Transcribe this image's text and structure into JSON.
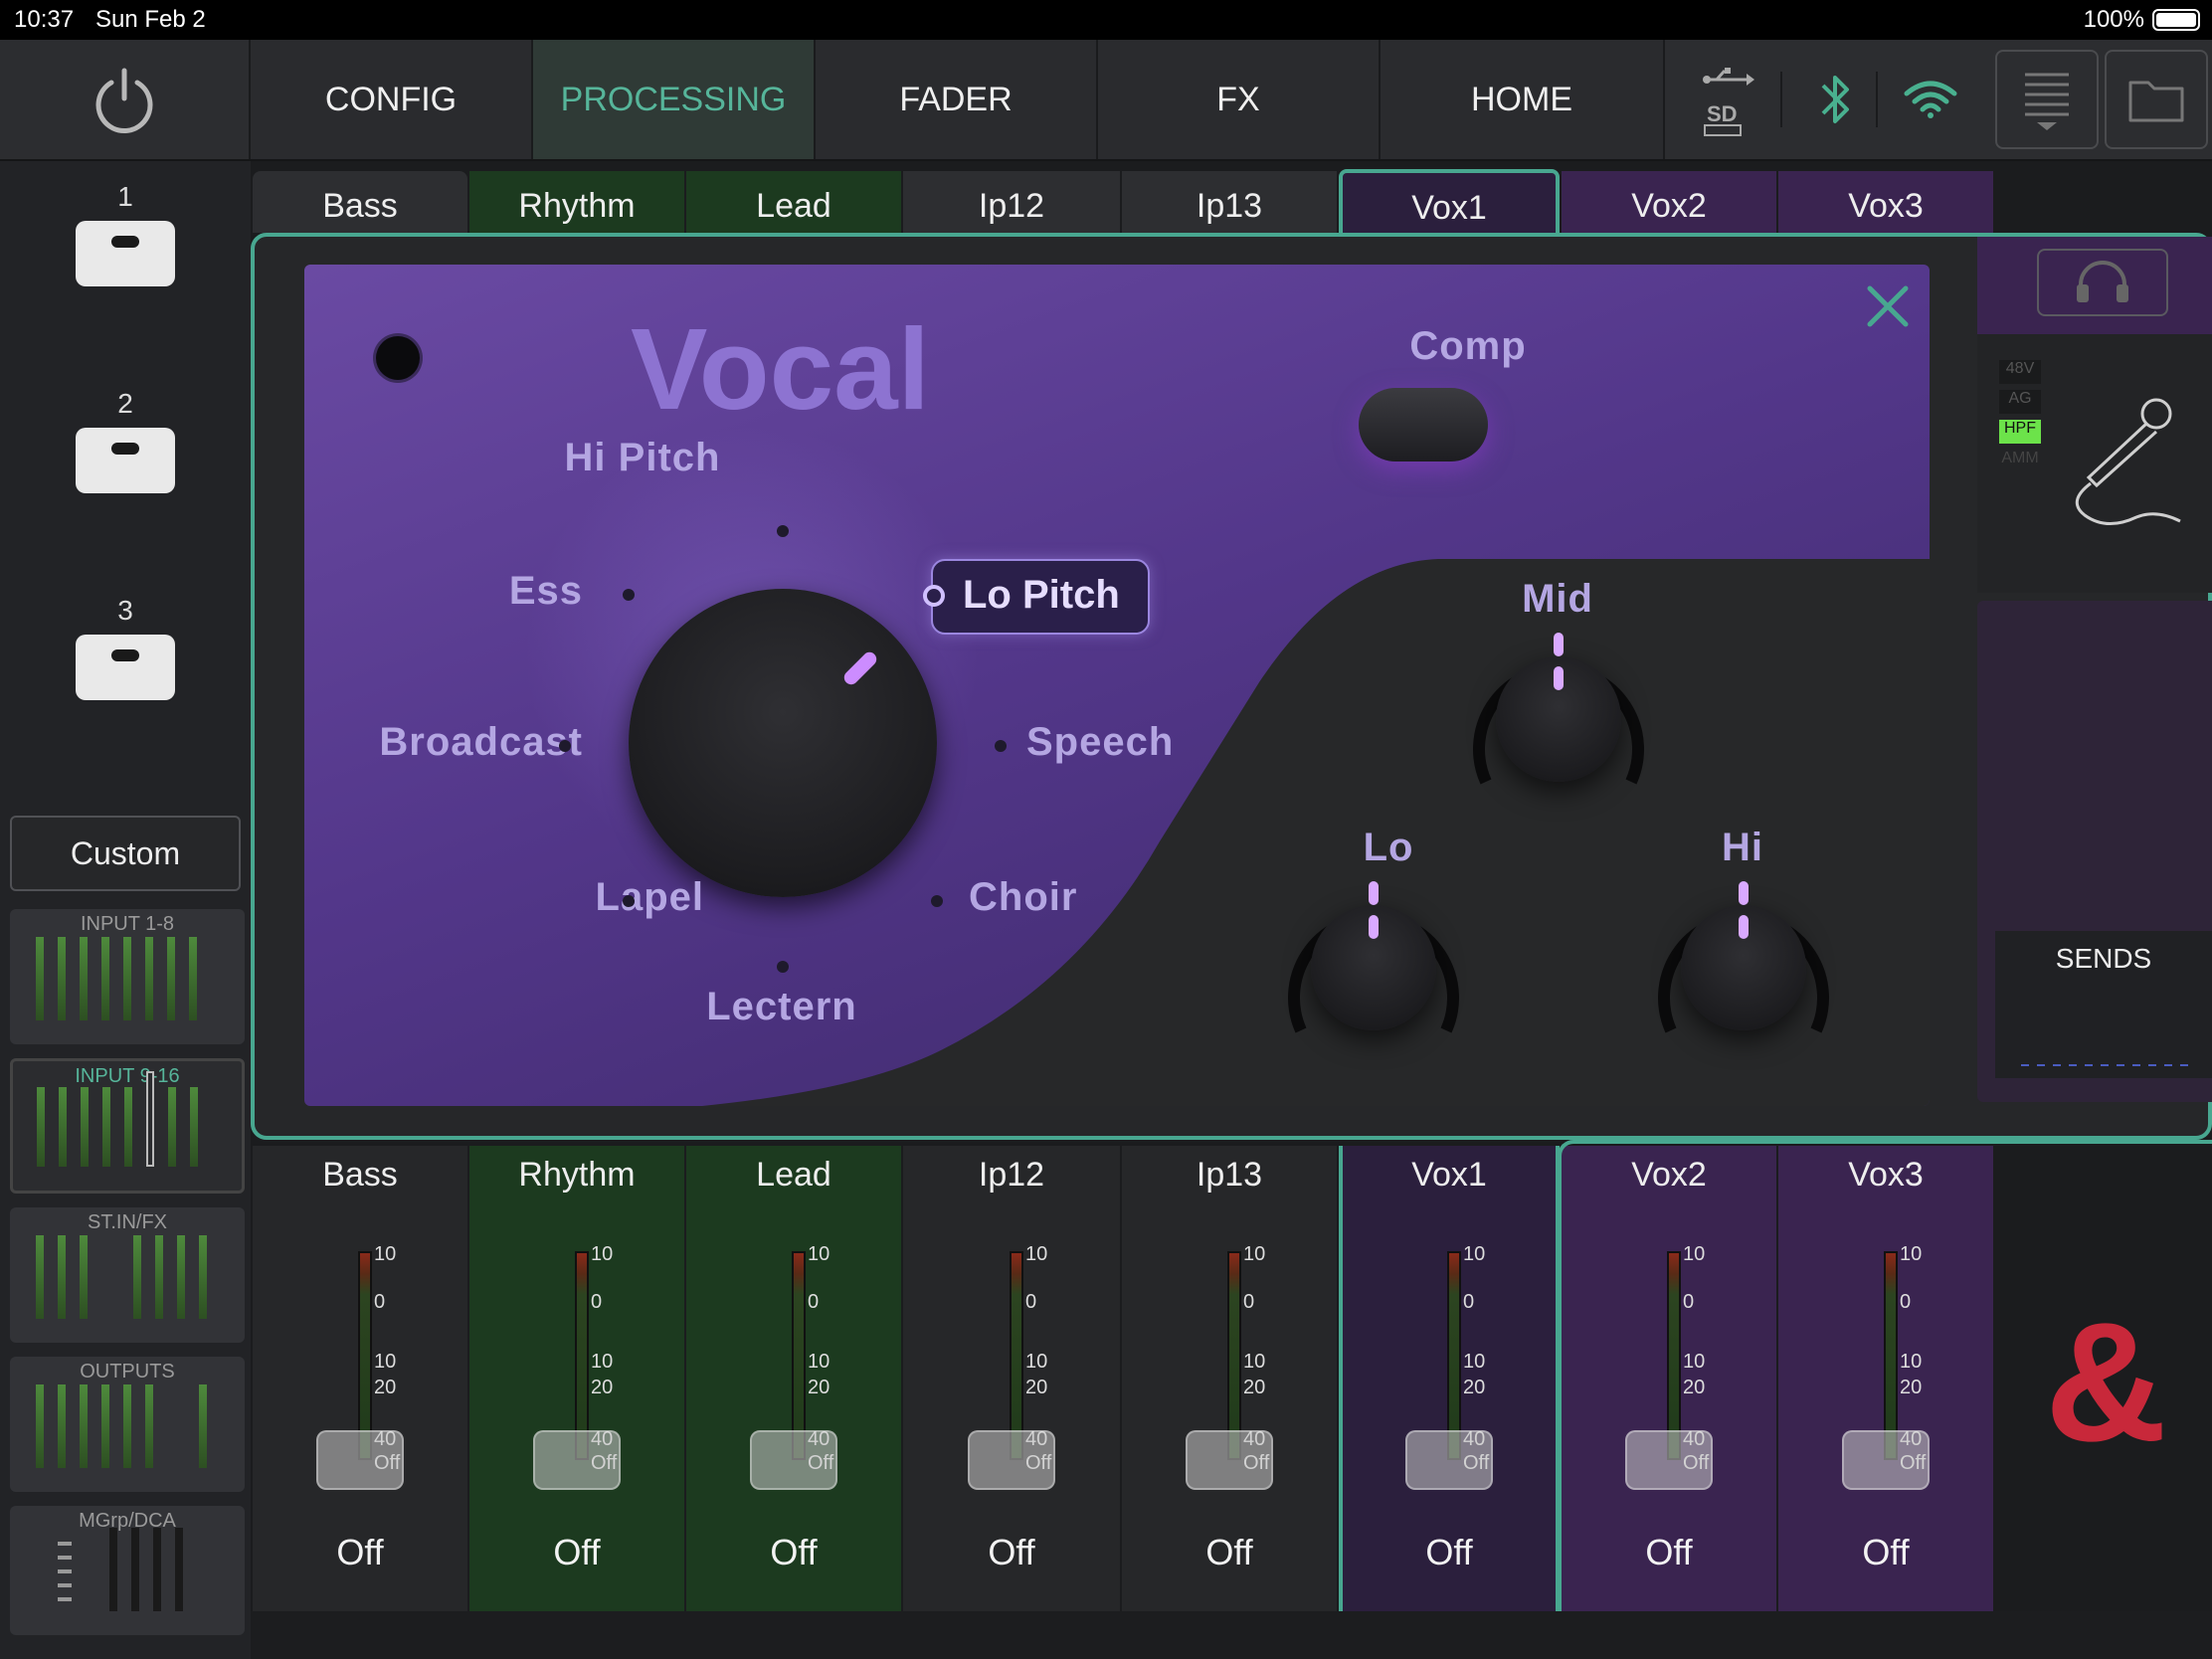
{
  "status_bar": {
    "time": "10:37",
    "date": "Sun Feb 2",
    "battery": "100%"
  },
  "nav": {
    "tabs": [
      "CONFIG",
      "PROCESSING",
      "FADER",
      "FX",
      "HOME"
    ],
    "active": "PROCESSING",
    "icons": [
      "power-icon",
      "usb-icon",
      "sd-card-icon",
      "bluetooth-icon",
      "wifi-icon",
      "menu-icon",
      "folder-icon"
    ]
  },
  "sidebar": {
    "scenes": [
      "1",
      "2",
      "3"
    ],
    "custom_label": "Custom",
    "banks": [
      "INPUT 1-8",
      "INPUT 9-16",
      "ST.IN/FX",
      "OUTPUTS",
      "MGrp/DCA"
    ],
    "active_bank": "INPUT 9-16"
  },
  "channels": [
    "Bass",
    "Rhythm",
    "Lead",
    "Ip12",
    "Ip13",
    "Vox1",
    "Vox2",
    "Vox3"
  ],
  "selected_channel": "Vox1",
  "vocal_panel": {
    "title": "Vocal",
    "comp_label": "Comp",
    "selector_positions": [
      "Hi Pitch",
      "Lo Pitch",
      "Speech",
      "Choir",
      "Lectern",
      "Lapel",
      "Broadcast",
      "Ess"
    ],
    "selected_position": "Lo Pitch",
    "eq_knobs": [
      "Mid",
      "Lo",
      "Hi"
    ]
  },
  "right_panel": {
    "badges": [
      "48V",
      "AG",
      "HPF",
      "AMM"
    ],
    "active_badge": "HPF",
    "sends_label": "SENDS"
  },
  "fader_scale": [
    "10",
    "0",
    "10",
    "20",
    "40",
    "Off"
  ],
  "fader_values": [
    "Off",
    "Off",
    "Off",
    "Off",
    "Off",
    "Off",
    "Off",
    "Off"
  ],
  "colors": {
    "accent": "#56b59a",
    "vocal_bg": "#5a3d92",
    "green_strip": "#1e3a1f",
    "purple_strip": "#3a2450",
    "logo": "#c8283a"
  }
}
